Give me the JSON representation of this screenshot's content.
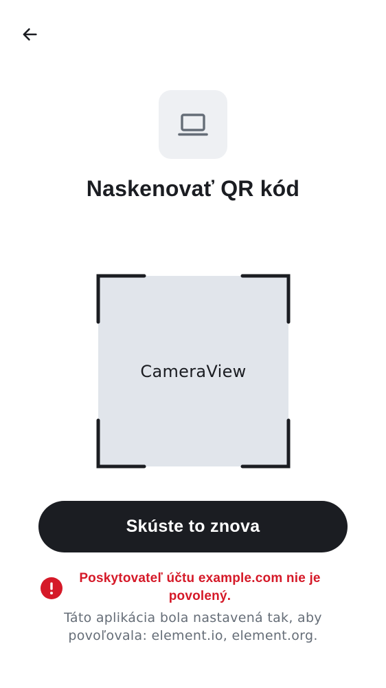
{
  "header": {
    "back_icon": "arrow-left-icon"
  },
  "hero": {
    "icon": "laptop-icon",
    "title": "Naskenovať QR kód"
  },
  "camera": {
    "label": "CameraView"
  },
  "actions": {
    "retry_label": "Skúste to znova"
  },
  "error": {
    "icon": "error-exclamation-icon",
    "message_line1": "Poskytovateľ účtu example.com nie je",
    "message_line2": "povolený.",
    "info_line1": "Táto aplikácia bola nastavená tak, aby",
    "info_line2": "povoľovala: element.io, element.org."
  },
  "colors": {
    "primary": "#1b1d22",
    "error": "#d51928",
    "secondary_text": "#656d77",
    "camera_bg": "#e1e5eb",
    "icon_tile_bg": "#eef0f3"
  }
}
